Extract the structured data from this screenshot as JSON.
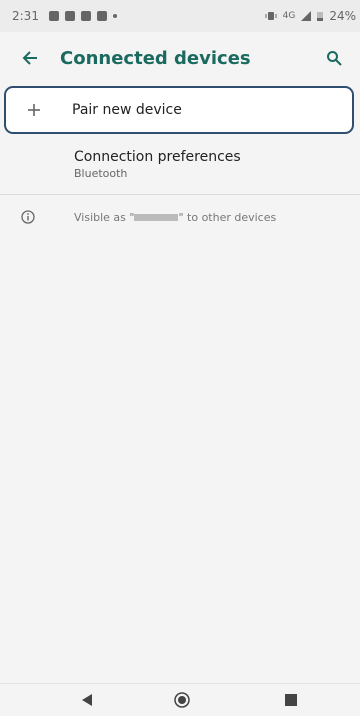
{
  "status_bar": {
    "time": "2:31",
    "network": "4G",
    "battery": "24%"
  },
  "toolbar": {
    "title": "Connected devices"
  },
  "items": {
    "pair_new_device": "Pair new device",
    "connection_preferences": {
      "title": "Connection preferences",
      "subtitle": "Bluetooth"
    },
    "visibility": {
      "prefix": "Visible as \"",
      "suffix": "\" to other devices"
    }
  },
  "colors": {
    "accent": "#1b6a5f",
    "highlight_border": "#2f4f6f"
  },
  "icons": {
    "back": "arrow-left-icon",
    "search": "search-icon",
    "add": "plus-icon",
    "info": "info-icon",
    "nav_back": "triangle-back-icon",
    "nav_home": "circle-home-icon",
    "nav_recents": "square-recents-icon"
  }
}
